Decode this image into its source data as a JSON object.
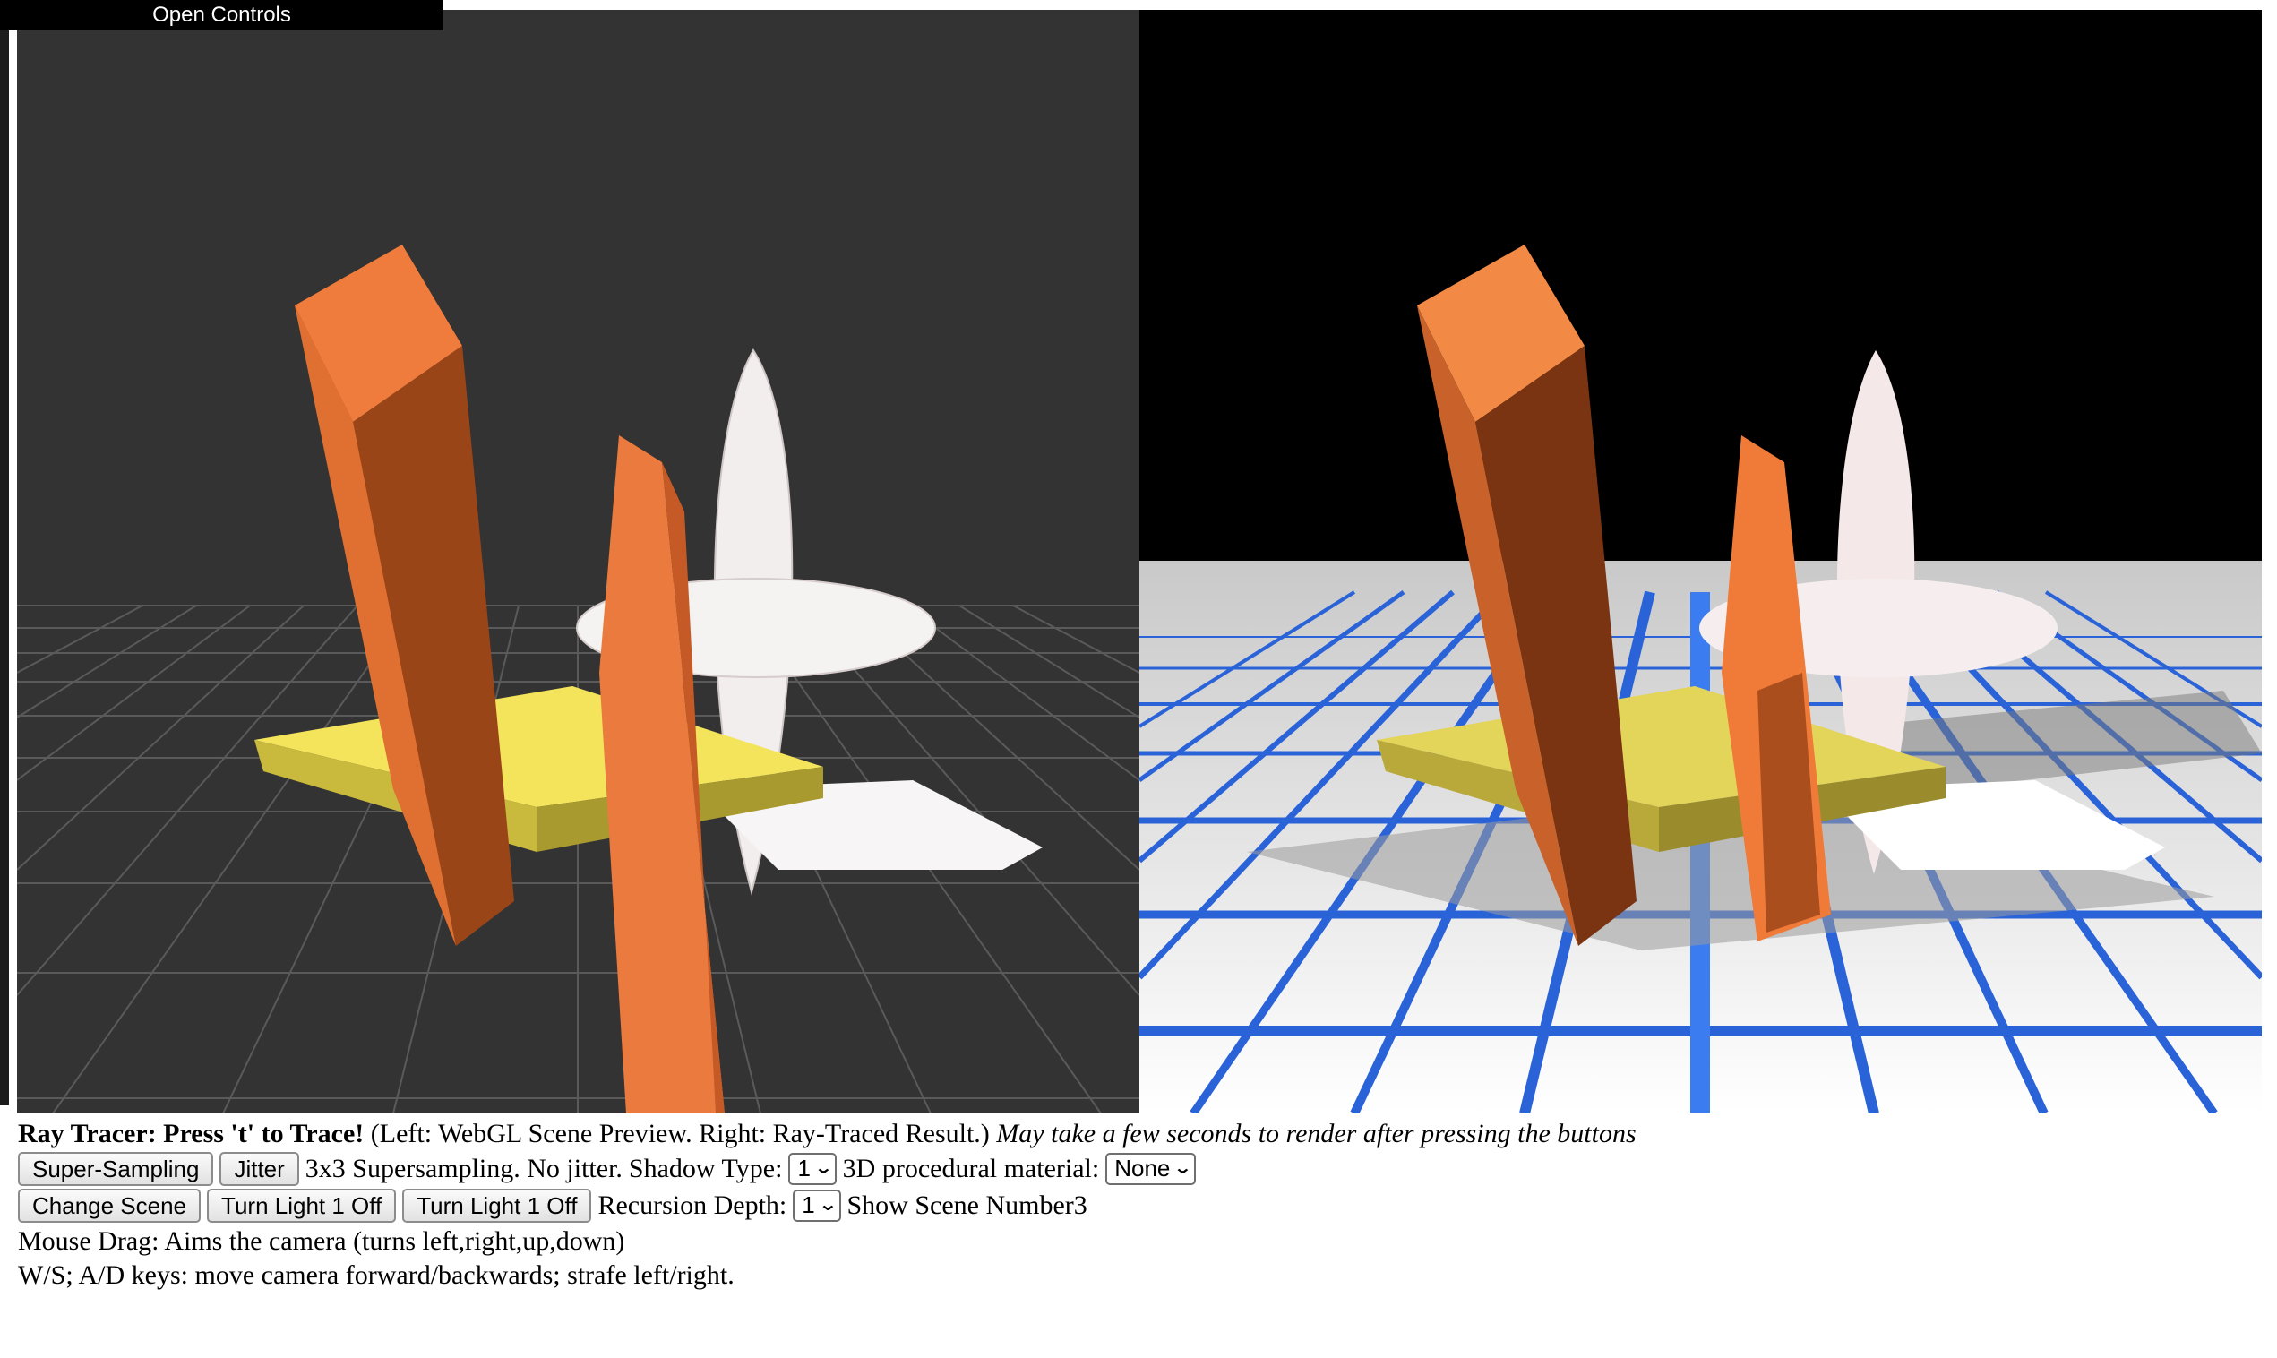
{
  "gui": {
    "open_controls": "Open Controls"
  },
  "header": {
    "title": "Ray Tracer: Press 't' to Trace!",
    "subtitle": "(Left: WebGL Scene Preview. Right: Ray-Traced Result.)",
    "note": "May take a few seconds to render after pressing the buttons"
  },
  "controls": {
    "super_sampling_btn": "Super-Sampling",
    "jitter_btn": "Jitter",
    "sampling_status": "3x3 Supersampling. No jitter.",
    "shadow_label": "Shadow Type:",
    "shadow_value": "1",
    "material_label": "3D procedural material:",
    "material_value": "None",
    "change_scene_btn": "Change Scene",
    "light1_btn_a": "Turn Light 1 Off",
    "light1_btn_b": "Turn Light 1 Off",
    "recursion_label": "Recursion Depth:",
    "recursion_value": "1",
    "scene_status": "Show Scene Number3"
  },
  "help": {
    "mouse": "Mouse Drag: Aims the camera (turns left,right,up,down)",
    "keys": "W/S; A/D keys: move camera forward/backwards; strafe left/right."
  },
  "colors": {
    "preview_bg": "#333333",
    "trace_sky": "#000000",
    "orange": "#e8733a",
    "yellow": "#f2e25a",
    "grid_blue": "#2d6fe6"
  }
}
